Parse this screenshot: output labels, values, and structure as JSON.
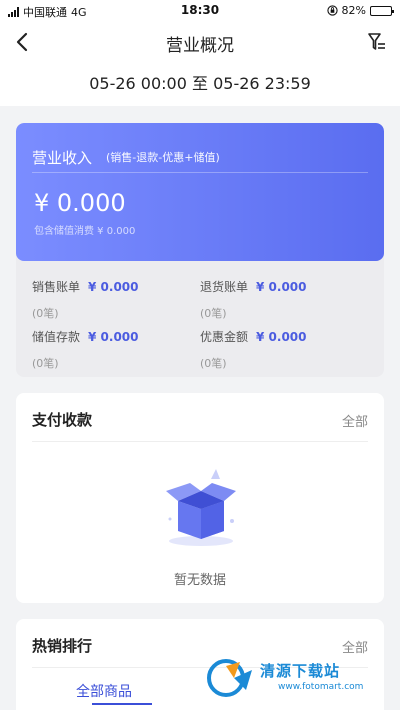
{
  "status_bar": {
    "carrier": "中国联通",
    "network": "4G",
    "time": "18:30",
    "battery": "82%",
    "battery_level": 0.82
  },
  "nav": {
    "title": "营业概况"
  },
  "date_range": "05-26 00:00 至 05-26 23:59",
  "income": {
    "title": "营业收入",
    "formula": "(销售-退款-优惠+储值)",
    "amount": "¥ 0.000",
    "note": "包含储值消费 ¥ 0.000",
    "stats": [
      {
        "label": "销售账单",
        "value": "¥ 0.000",
        "count": "(0笔)"
      },
      {
        "label": "退货账单",
        "value": "¥ 0.000",
        "count": "(0笔)"
      },
      {
        "label": "储值存款",
        "value": "¥ 0.000",
        "count": "(0笔)"
      },
      {
        "label": "优惠金额",
        "value": "¥ 0.000",
        "count": "(0笔)"
      }
    ]
  },
  "payment": {
    "title": "支付收款",
    "all_label": "全部",
    "empty_text": "暂无数据"
  },
  "hot_sales": {
    "title": "热销排行",
    "all_label": "全部",
    "tab_label": "全部商品"
  },
  "watermark": {
    "title": "清源下载站",
    "url": "www.fotomart.com"
  },
  "colors": {
    "accent": "#4b5ce0",
    "gradient_start": "#7b8dff",
    "gradient_end": "#5a6df0",
    "background": "#f2f3f5"
  }
}
